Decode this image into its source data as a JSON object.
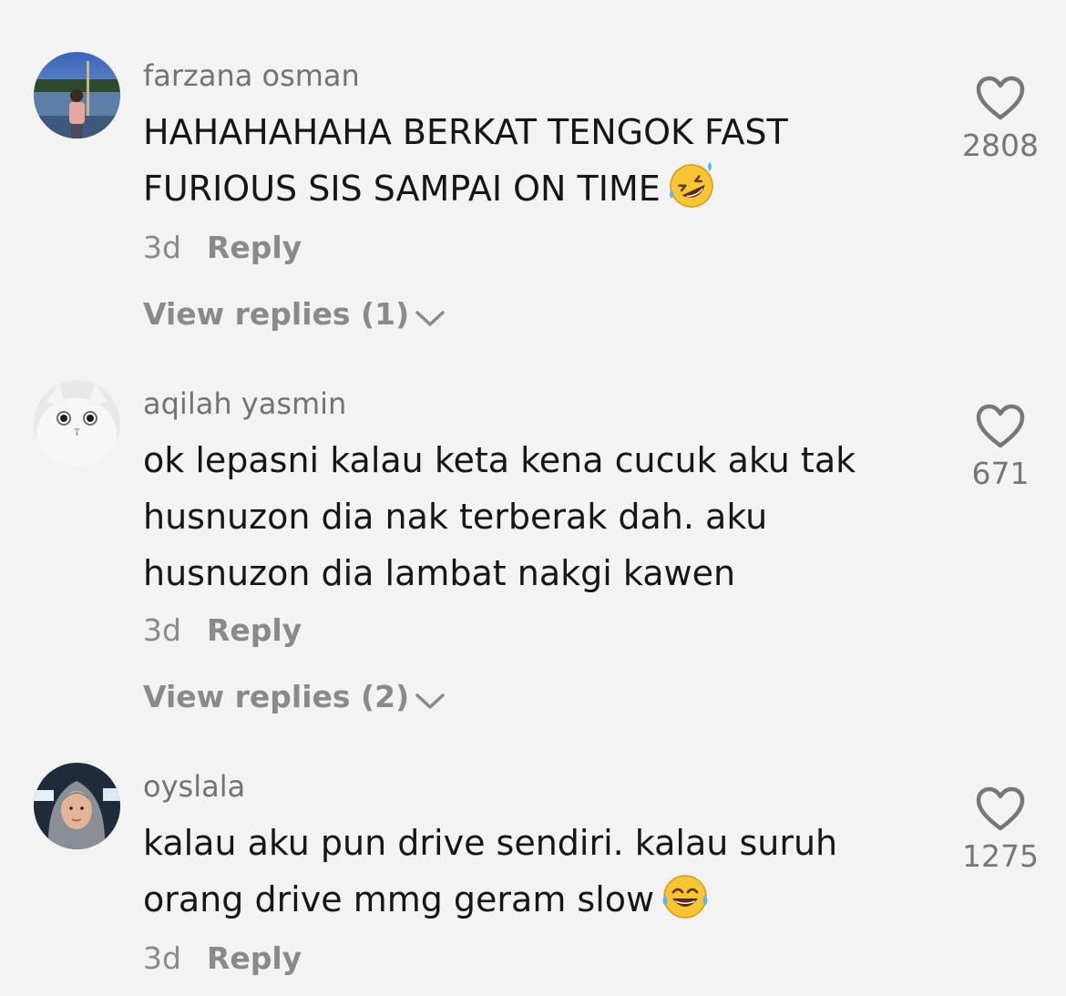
{
  "colors": {
    "background": "#f3f3f3",
    "text_primary": "#161616",
    "text_secondary": "#737373",
    "icon": "#777777"
  },
  "comments": [
    {
      "username": "farzana osman",
      "lines": [
        "HAHAHAHAHA BERKAT TENGOK FAST",
        "FURIOUS SIS SAMPAI ON TIME"
      ],
      "emoji": "rolling-on-floor-laughing-emoji",
      "time": "3d",
      "reply_label": "Reply",
      "view_replies": "View replies (1)",
      "like_count": "2808",
      "like_icon": "heart-outline-icon"
    },
    {
      "username": "aqilah yasmin",
      "lines": [
        "ok lepasni kalau keta kena cucuk aku tak",
        "husnuzon dia nak terberak dah. aku",
        "husnuzon dia lambat nakgi kawen"
      ],
      "time": "3d",
      "reply_label": "Reply",
      "view_replies": "View replies (2)",
      "like_count": "671",
      "like_icon": "heart-outline-icon"
    },
    {
      "username": "oyslala",
      "lines": [
        "kalau aku pun drive sendiri. kalau suruh",
        "orang drive mmg geram slow"
      ],
      "emoji": "face-with-tears-of-joy-emoji",
      "time": "3d",
      "reply_label": "Reply",
      "like_count": "1275",
      "like_icon": "heart-outline-icon"
    }
  ]
}
